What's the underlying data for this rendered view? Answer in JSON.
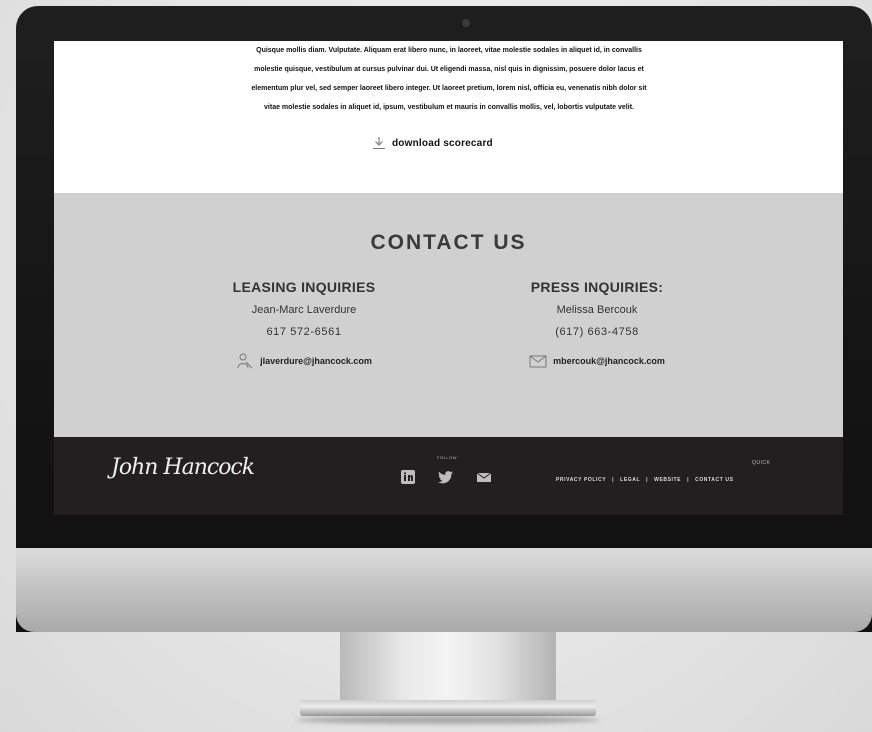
{
  "intro": {
    "lines": [
      "Quisque mollis diam. Vulputate. Aliquam erat libero nunc, in laoreet, vitae molestie sodales in aliquet id, in convallis",
      "molestie quisque, vestibulum at cursus pulvinar dui. Ut eligendi massa, nisl quis in dignissim, posuere dolor lacus et",
      "elementum plur vel, sed semper laoreet libero integer. Ut laoreet pretium, lorem nisl, officia eu, venenatis nibh dolor sit",
      "vitae molestie sodales in aliquet id, ipsum, vestibulum et mauris in convallis mollis, vel, lobortis vulputate velit."
    ],
    "download_label": "download scorecard"
  },
  "contact": {
    "title": "CONTACT US",
    "leasing": {
      "heading": "LEASING INQUIRIES",
      "name": "Jean-Marc Laverdure",
      "phone": "617 572-6561",
      "email": "jlaverdure@jhancock.com"
    },
    "press": {
      "heading": "PRESS INQUIRIES:",
      "name": "Melissa Bercouk",
      "phone": "(617) 663-4758",
      "email": "mbercouk@jhancock.com"
    }
  },
  "footer": {
    "logo_text": "John Hancock",
    "follow_label": "FOLLOW",
    "links_heading": "QUICK",
    "links": [
      "PRIVACY POLICY",
      "LEGAL",
      "WEBSITE",
      "CONTACT US"
    ],
    "separator": "|"
  },
  "icons": {
    "download": "download-icon",
    "leasing_email": "person-icon",
    "press_email": "mail-envelope-icon",
    "social": [
      "linkedin-icon",
      "twitter-icon",
      "mail-icon"
    ]
  }
}
